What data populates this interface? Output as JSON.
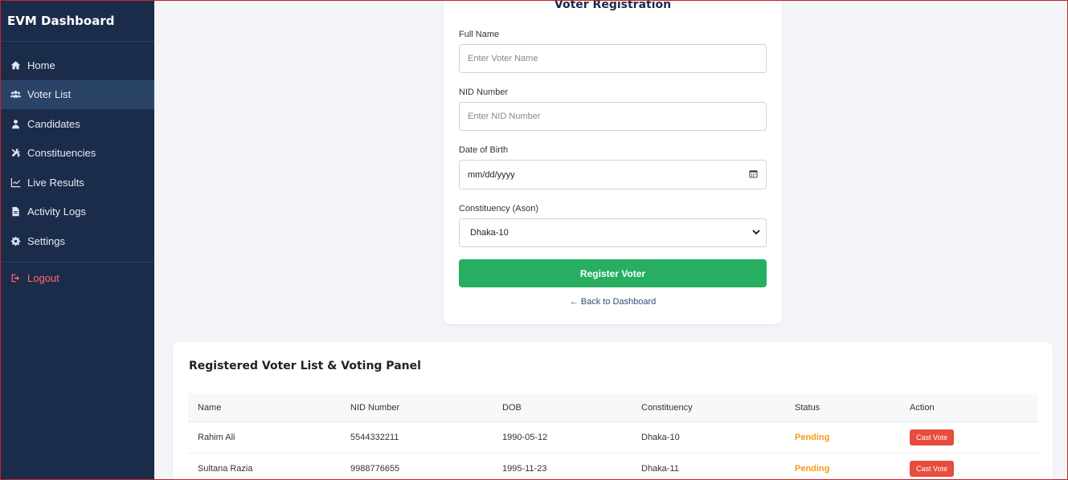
{
  "sidebar": {
    "brand": "EVM Dashboard",
    "items": [
      {
        "label": "Home",
        "icon": "home-icon"
      },
      {
        "label": "Voter List",
        "icon": "users-icon",
        "active": true
      },
      {
        "label": "Candidates",
        "icon": "user-icon"
      },
      {
        "label": "Constituencies",
        "icon": "tools-icon"
      },
      {
        "label": "Live Results",
        "icon": "chart-icon"
      },
      {
        "label": "Activity Logs",
        "icon": "file-icon"
      },
      {
        "label": "Settings",
        "icon": "gear-icon"
      }
    ],
    "logout": "Logout"
  },
  "form": {
    "title": "Voter Registration",
    "full_name_label": "Full Name",
    "full_name_placeholder": "Enter Voter Name",
    "nid_label": "NID Number",
    "nid_placeholder": "Enter NID Number",
    "dob_label": "Date of Birth",
    "dob_value": "mm/dd/yyyy",
    "constituency_label": "Constituency (Ason)",
    "constituency_value": "Dhaka-10",
    "register_button": "Register Voter",
    "back_link": "← Back to Dashboard"
  },
  "voter_list": {
    "title": "Registered Voter List & Voting Panel",
    "columns": [
      "Name",
      "NID Number",
      "DOB",
      "Constituency",
      "Status",
      "Action"
    ],
    "rows": [
      {
        "name": "Rahim Ali",
        "nid": "5544332211",
        "dob": "1990-05-12",
        "constituency": "Dhaka-10",
        "status": "Pending",
        "action": "Cast Vote"
      },
      {
        "name": "Sultana Razia",
        "nid": "9988776655",
        "dob": "1995-11-23",
        "constituency": "Dhaka-11",
        "status": "Pending",
        "action": "Cast Vote"
      }
    ]
  },
  "colors": {
    "sidebar_bg": "#1b2c4a",
    "primary_green": "#27ae60",
    "pending_orange": "#f39c12",
    "vote_red": "#e74c3c",
    "logout_red": "#ff6b6b"
  }
}
